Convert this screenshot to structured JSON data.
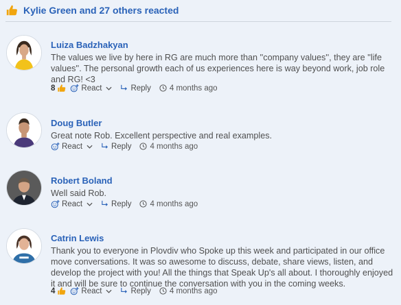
{
  "summary": {
    "text": "Kylie Green and 27 others reacted",
    "icon": "thumbs-up-icon"
  },
  "colors": {
    "link": "#2a62b8",
    "thumb": "#f1a50e",
    "background": "#edf2f9"
  },
  "comments": [
    {
      "author": "Luiza Badzhakyan",
      "text": "The values we live by here in RG are much more than ''company values'', they are ''life values''. The personal growth each of us experiences here is way beyond work, job role and RG! <3",
      "reaction_count": "8",
      "react_label": "React",
      "reply_label": "Reply",
      "time": "4 months ago"
    },
    {
      "author": "Doug Butler",
      "text": "Great note Rob.  Excellent perspective and real examples.",
      "reaction_count": "",
      "react_label": "React",
      "reply_label": "Reply",
      "time": "4 months ago"
    },
    {
      "author": "Robert Boland",
      "text": "Well said Rob.",
      "reaction_count": "",
      "react_label": "React",
      "reply_label": "Reply",
      "time": "4 months ago"
    },
    {
      "author": "Catrin Lewis",
      "text": "Thank you to everyone in Plovdiv who Spoke up this week and participated in our office move conversations. It was so awesome to discuss, debate, share views, listen, and develop the project with you! All the things that Speak Up's all about. I thoroughly enjoyed it and will be sure to continue the conversation with you in the coming weeks.",
      "reaction_count": "4",
      "react_label": "React",
      "reply_label": "Reply",
      "time": "4 months ago"
    }
  ]
}
